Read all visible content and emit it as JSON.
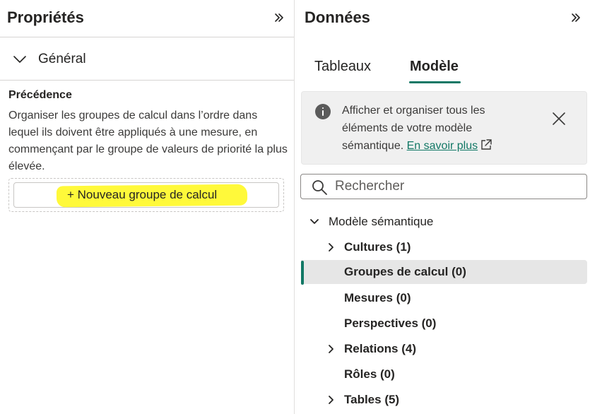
{
  "properties_pane": {
    "title": "Propriétés",
    "section": "Général",
    "precedence_title": "Précédence",
    "precedence_description": "Organiser les groupes de calcul dans l’ordre dans lequel ils doivent être appliqués à une mesure, en commençant par le groupe de valeurs de priorité la plus élevée.",
    "new_group_button": "+ Nouveau groupe de calcul"
  },
  "data_pane": {
    "title": "Données",
    "tabs": [
      {
        "label": "Tableaux",
        "active": false
      },
      {
        "label": "Modèle",
        "active": true
      }
    ],
    "info": {
      "text": "Afficher et organiser tous les éléments de votre modèle sémantique.",
      "link": "En savoir plus"
    },
    "search": {
      "placeholder": "Rechercher",
      "value": ""
    },
    "tree": {
      "root": "Modèle sémantique",
      "items": [
        {
          "label": "Cultures (1)",
          "expandable": true,
          "selected": false
        },
        {
          "label": "Groupes de calcul (0)",
          "expandable": false,
          "selected": true
        },
        {
          "label": "Mesures (0)",
          "expandable": false,
          "selected": false
        },
        {
          "label": "Perspectives (0)",
          "expandable": false,
          "selected": false
        },
        {
          "label": "Relations (4)",
          "expandable": true,
          "selected": false
        },
        {
          "label": "Rôles (0)",
          "expandable": false,
          "selected": false
        },
        {
          "label": "Tables (5)",
          "expandable": true,
          "selected": false
        }
      ]
    }
  },
  "colors": {
    "accent": "#117865",
    "highlight": "#fff93a",
    "selected_row": "#e6e6e6",
    "info_background": "#f0f0f0"
  },
  "icons": [
    "collapse-pane-icon",
    "chevron-down-icon",
    "info-icon",
    "external-link-icon",
    "close-icon",
    "search-icon",
    "chevron-right-icon"
  ]
}
